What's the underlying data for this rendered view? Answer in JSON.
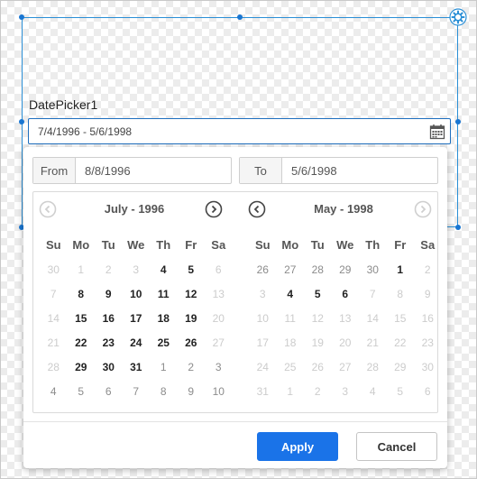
{
  "widget": {
    "label": "DatePicker1",
    "value": "7/4/1996 - 5/6/1998",
    "icons": {
      "settings": "gear-icon",
      "calendar": "calendar-icon"
    }
  },
  "range": {
    "from_label": "From",
    "from_value": "8/8/1996",
    "to_label": "To",
    "to_value": "5/6/1998"
  },
  "weekdays": [
    "Su",
    "Mo",
    "Tu",
    "We",
    "Th",
    "Fr",
    "Sa"
  ],
  "left_month": {
    "title": "July - 1996",
    "days": [
      {
        "d": "30",
        "s": "dis"
      },
      {
        "d": "1",
        "s": "dis"
      },
      {
        "d": "2",
        "s": "dis"
      },
      {
        "d": "3",
        "s": "dis"
      },
      {
        "d": "4",
        "s": "cur"
      },
      {
        "d": "5",
        "s": "cur"
      },
      {
        "d": "6",
        "s": "dis"
      },
      {
        "d": "7",
        "s": "dis"
      },
      {
        "d": "8",
        "s": "cur"
      },
      {
        "d": "9",
        "s": "cur"
      },
      {
        "d": "10",
        "s": "cur"
      },
      {
        "d": "11",
        "s": "cur"
      },
      {
        "d": "12",
        "s": "cur"
      },
      {
        "d": "13",
        "s": "dis"
      },
      {
        "d": "14",
        "s": "dis"
      },
      {
        "d": "15",
        "s": "cur"
      },
      {
        "d": "16",
        "s": "cur"
      },
      {
        "d": "17",
        "s": "cur"
      },
      {
        "d": "18",
        "s": "cur"
      },
      {
        "d": "19",
        "s": "cur"
      },
      {
        "d": "20",
        "s": "dis"
      },
      {
        "d": "21",
        "s": "dis"
      },
      {
        "d": "22",
        "s": "cur"
      },
      {
        "d": "23",
        "s": "cur"
      },
      {
        "d": "24",
        "s": "cur"
      },
      {
        "d": "25",
        "s": "cur"
      },
      {
        "d": "26",
        "s": "cur"
      },
      {
        "d": "27",
        "s": "dis"
      },
      {
        "d": "28",
        "s": "dis"
      },
      {
        "d": "29",
        "s": "cur"
      },
      {
        "d": "30",
        "s": "cur"
      },
      {
        "d": "31",
        "s": "cur"
      },
      {
        "d": "1",
        "s": "other"
      },
      {
        "d": "2",
        "s": "other"
      },
      {
        "d": "3",
        "s": "other"
      },
      {
        "d": "4",
        "s": "other"
      },
      {
        "d": "5",
        "s": "other"
      },
      {
        "d": "6",
        "s": "other"
      },
      {
        "d": "7",
        "s": "other"
      },
      {
        "d": "8",
        "s": "other"
      },
      {
        "d": "9",
        "s": "other"
      },
      {
        "d": "10",
        "s": "other"
      }
    ]
  },
  "right_month": {
    "title": "May - 1998",
    "days": [
      {
        "d": "26",
        "s": "other"
      },
      {
        "d": "27",
        "s": "other"
      },
      {
        "d": "28",
        "s": "other"
      },
      {
        "d": "29",
        "s": "other"
      },
      {
        "d": "30",
        "s": "other"
      },
      {
        "d": "1",
        "s": "cur"
      },
      {
        "d": "2",
        "s": "dis"
      },
      {
        "d": "3",
        "s": "dis"
      },
      {
        "d": "4",
        "s": "cur"
      },
      {
        "d": "5",
        "s": "cur"
      },
      {
        "d": "6",
        "s": "cur"
      },
      {
        "d": "7",
        "s": "dis"
      },
      {
        "d": "8",
        "s": "dis"
      },
      {
        "d": "9",
        "s": "dis"
      },
      {
        "d": "10",
        "s": "dis"
      },
      {
        "d": "11",
        "s": "dis"
      },
      {
        "d": "12",
        "s": "dis"
      },
      {
        "d": "13",
        "s": "dis"
      },
      {
        "d": "14",
        "s": "dis"
      },
      {
        "d": "15",
        "s": "dis"
      },
      {
        "d": "16",
        "s": "dis"
      },
      {
        "d": "17",
        "s": "dis"
      },
      {
        "d": "18",
        "s": "dis"
      },
      {
        "d": "19",
        "s": "dis"
      },
      {
        "d": "20",
        "s": "dis"
      },
      {
        "d": "21",
        "s": "dis"
      },
      {
        "d": "22",
        "s": "dis"
      },
      {
        "d": "23",
        "s": "dis"
      },
      {
        "d": "24",
        "s": "dis"
      },
      {
        "d": "25",
        "s": "dis"
      },
      {
        "d": "26",
        "s": "dis"
      },
      {
        "d": "27",
        "s": "dis"
      },
      {
        "d": "28",
        "s": "dis"
      },
      {
        "d": "29",
        "s": "dis"
      },
      {
        "d": "30",
        "s": "dis"
      },
      {
        "d": "31",
        "s": "dis"
      },
      {
        "d": "1",
        "s": "dis"
      },
      {
        "d": "2",
        "s": "dis"
      },
      {
        "d": "3",
        "s": "dis"
      },
      {
        "d": "4",
        "s": "dis"
      },
      {
        "d": "5",
        "s": "dis"
      },
      {
        "d": "6",
        "s": "dis"
      }
    ]
  },
  "nav": {
    "prev_icon": "chevron-left-icon",
    "next_icon": "chevron-right-icon"
  },
  "buttons": {
    "apply": "Apply",
    "cancel": "Cancel"
  },
  "colors": {
    "accent": "#1a73e8",
    "selection": "#2a8fd6"
  }
}
